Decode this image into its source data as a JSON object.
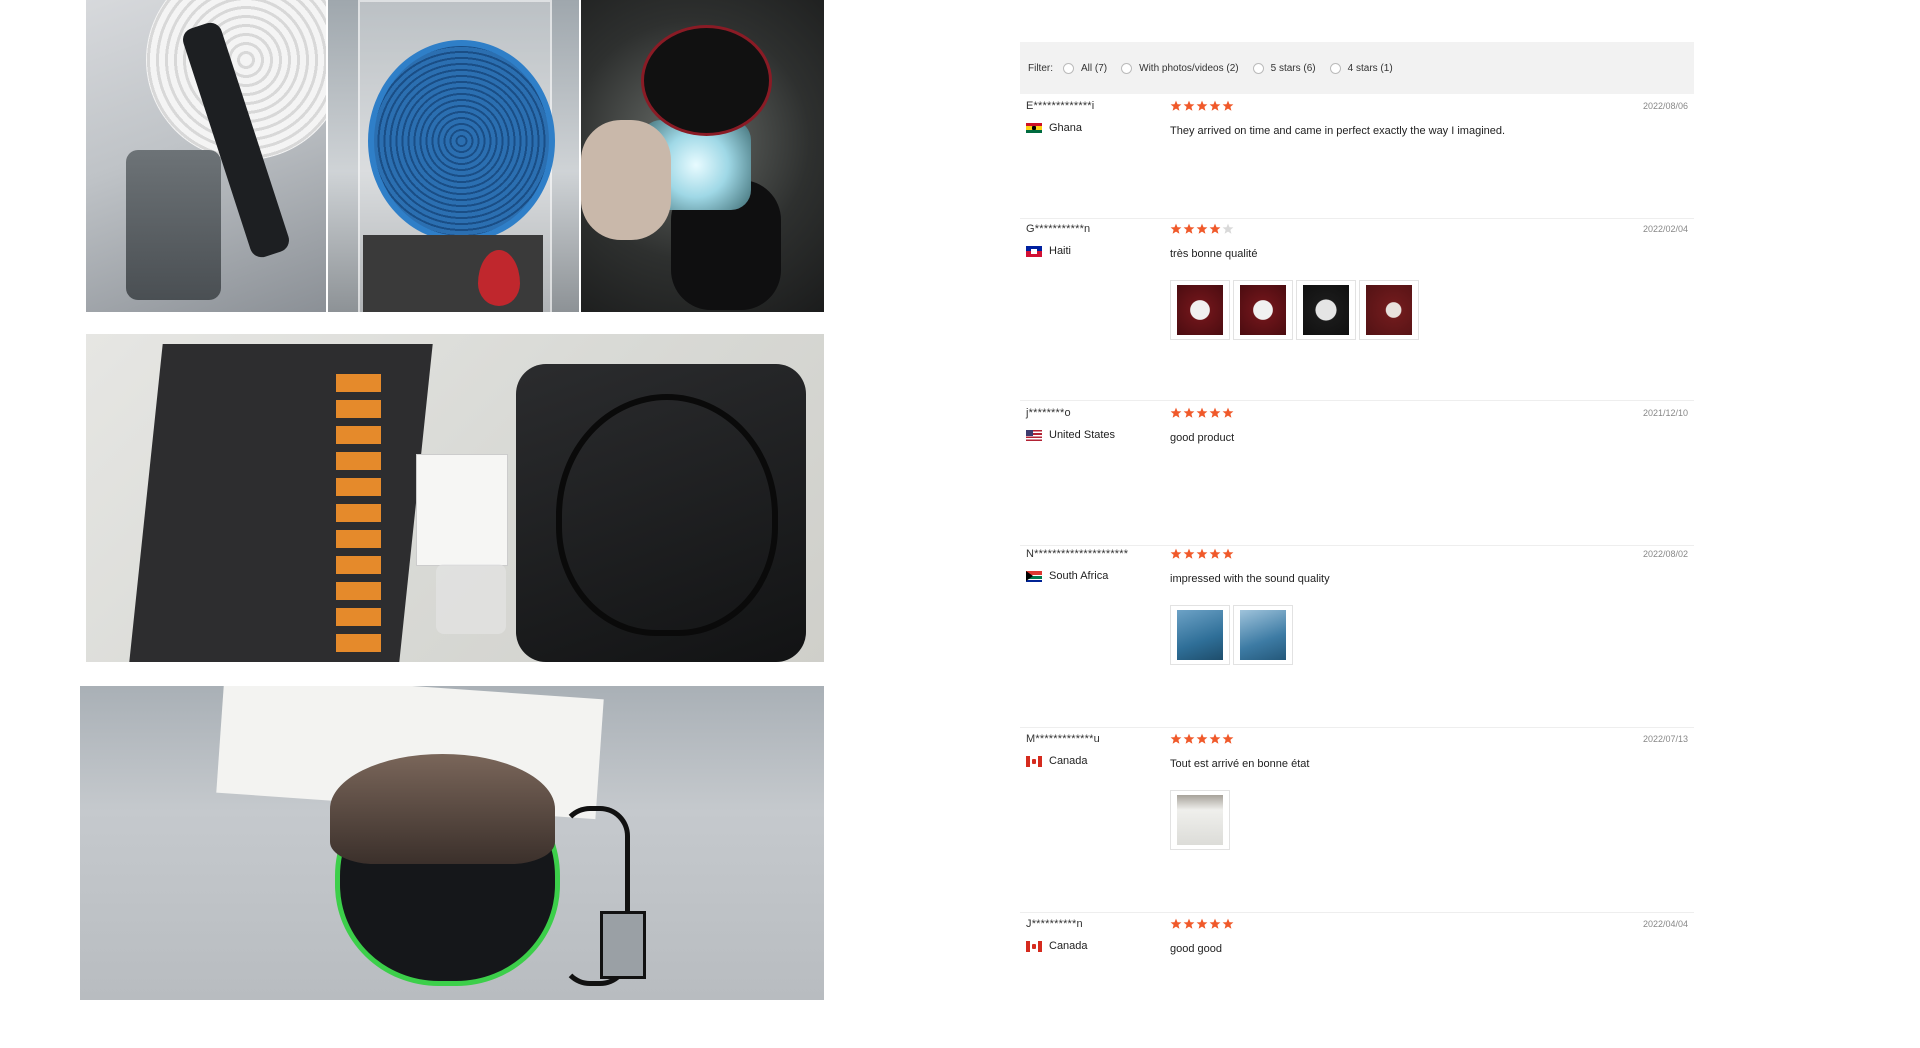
{
  "filter": {
    "label": "Filter:",
    "options": [
      {
        "label": "All (7)"
      },
      {
        "label": "With photos/videos (2)"
      },
      {
        "label": "5 stars (6)"
      },
      {
        "label": "4 stars (1)"
      }
    ]
  },
  "reviews": [
    {
      "name": "E*************i",
      "country": "Ghana",
      "flag": "gh",
      "rating": 5,
      "date": "2022/08/06",
      "text": "They arrived on time and came in perfect exactly the way I imagined.",
      "photos": []
    },
    {
      "name": "G***********n",
      "country": "Haiti",
      "flag": "ht",
      "rating": 4,
      "date": "2022/02/04",
      "text": "très bonne qualité",
      "photos": [
        "t-red",
        "t-red",
        "t-dark",
        "t-red2"
      ]
    },
    {
      "name": "j********o",
      "country": "United States",
      "flag": "us",
      "rating": 5,
      "date": "2021/12/10",
      "text": "good product",
      "photos": []
    },
    {
      "name": "N*********************",
      "country": "South Africa",
      "flag": "za",
      "rating": 5,
      "date": "2022/08/02",
      "text": "impressed with the sound quality",
      "photos": [
        "t-blue",
        "t-blue2"
      ]
    },
    {
      "name": "M*************u",
      "country": "Canada",
      "flag": "ca",
      "rating": 5,
      "date": "2022/07/13",
      "text": "Tout est arrivé en bonne état",
      "photos": [
        "t-box"
      ]
    },
    {
      "name": "J**********n",
      "country": "Canada",
      "flag": "ca",
      "rating": 5,
      "date": "2022/04/04",
      "text": "good good",
      "photos": []
    }
  ],
  "colors": {
    "star_filled": "#f0592a",
    "star_empty": "#d9d9d9",
    "filter_bg": "#f2f2f2"
  }
}
